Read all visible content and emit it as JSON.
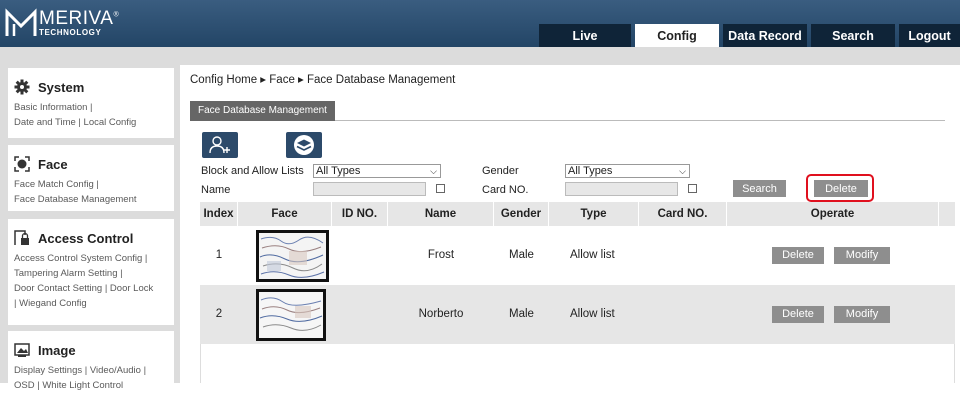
{
  "logo": {
    "name": "MERIVA",
    "sub": "TECHNOLOGY",
    "trademark": "®"
  },
  "tabs": [
    {
      "label": "Live",
      "active": false
    },
    {
      "label": "Config",
      "active": true
    },
    {
      "label": "Data Record",
      "active": false
    },
    {
      "label": "Search",
      "active": false
    },
    {
      "label": "Logout",
      "active": false
    }
  ],
  "sidebar": {
    "sections": [
      {
        "title": "System",
        "icon": "gear-icon",
        "links": [
          "Basic Information |",
          "Date and Time | Local Config"
        ]
      },
      {
        "title": "Face",
        "icon": "face-scan-icon",
        "links": [
          "Face Match Config |",
          "Face Database Management"
        ]
      },
      {
        "title": "Access Control",
        "icon": "door-lock-icon",
        "links": [
          "Access Control System Config |",
          "Tampering Alarm Setting |",
          "Door Contact Setting | Door Lock",
          " | Wiegand Config"
        ]
      },
      {
        "title": "Image",
        "icon": "image-icon",
        "links": [
          "Display Settings | Video/Audio |",
          "OSD | White Light Control"
        ]
      }
    ]
  },
  "breadcrumb": "Config Home ▸ Face ▸ Face Database Management",
  "subtab": "Face Database Management",
  "filters": {
    "block_allow_label": "Block and Allow Lists",
    "block_allow_value": "All Types",
    "gender_label": "Gender",
    "gender_value": "All Types",
    "name_label": "Name",
    "name_value": "",
    "card_label": "Card NO.",
    "card_value": "",
    "search_button": "Search",
    "delete_button": "Delete"
  },
  "table": {
    "headers": [
      "Index",
      "Face",
      "ID NO.",
      "Name",
      "Gender",
      "Type",
      "Card NO.",
      "Operate"
    ],
    "rows": [
      {
        "index": "1",
        "id_no": "",
        "name": "Frost",
        "gender": "Male",
        "type": "Allow list",
        "card_no": "",
        "delete": "Delete",
        "modify": "Modify"
      },
      {
        "index": "2",
        "id_no": "",
        "name": "Norberto",
        "gender": "Male",
        "type": "Allow list",
        "card_no": "",
        "delete": "Delete",
        "modify": "Modify"
      }
    ]
  },
  "colors": {
    "topbar": "#2c4d6e",
    "tab_dark": "#0f2438",
    "button_gray": "#8e8e8e",
    "highlight": "#e0101e"
  }
}
